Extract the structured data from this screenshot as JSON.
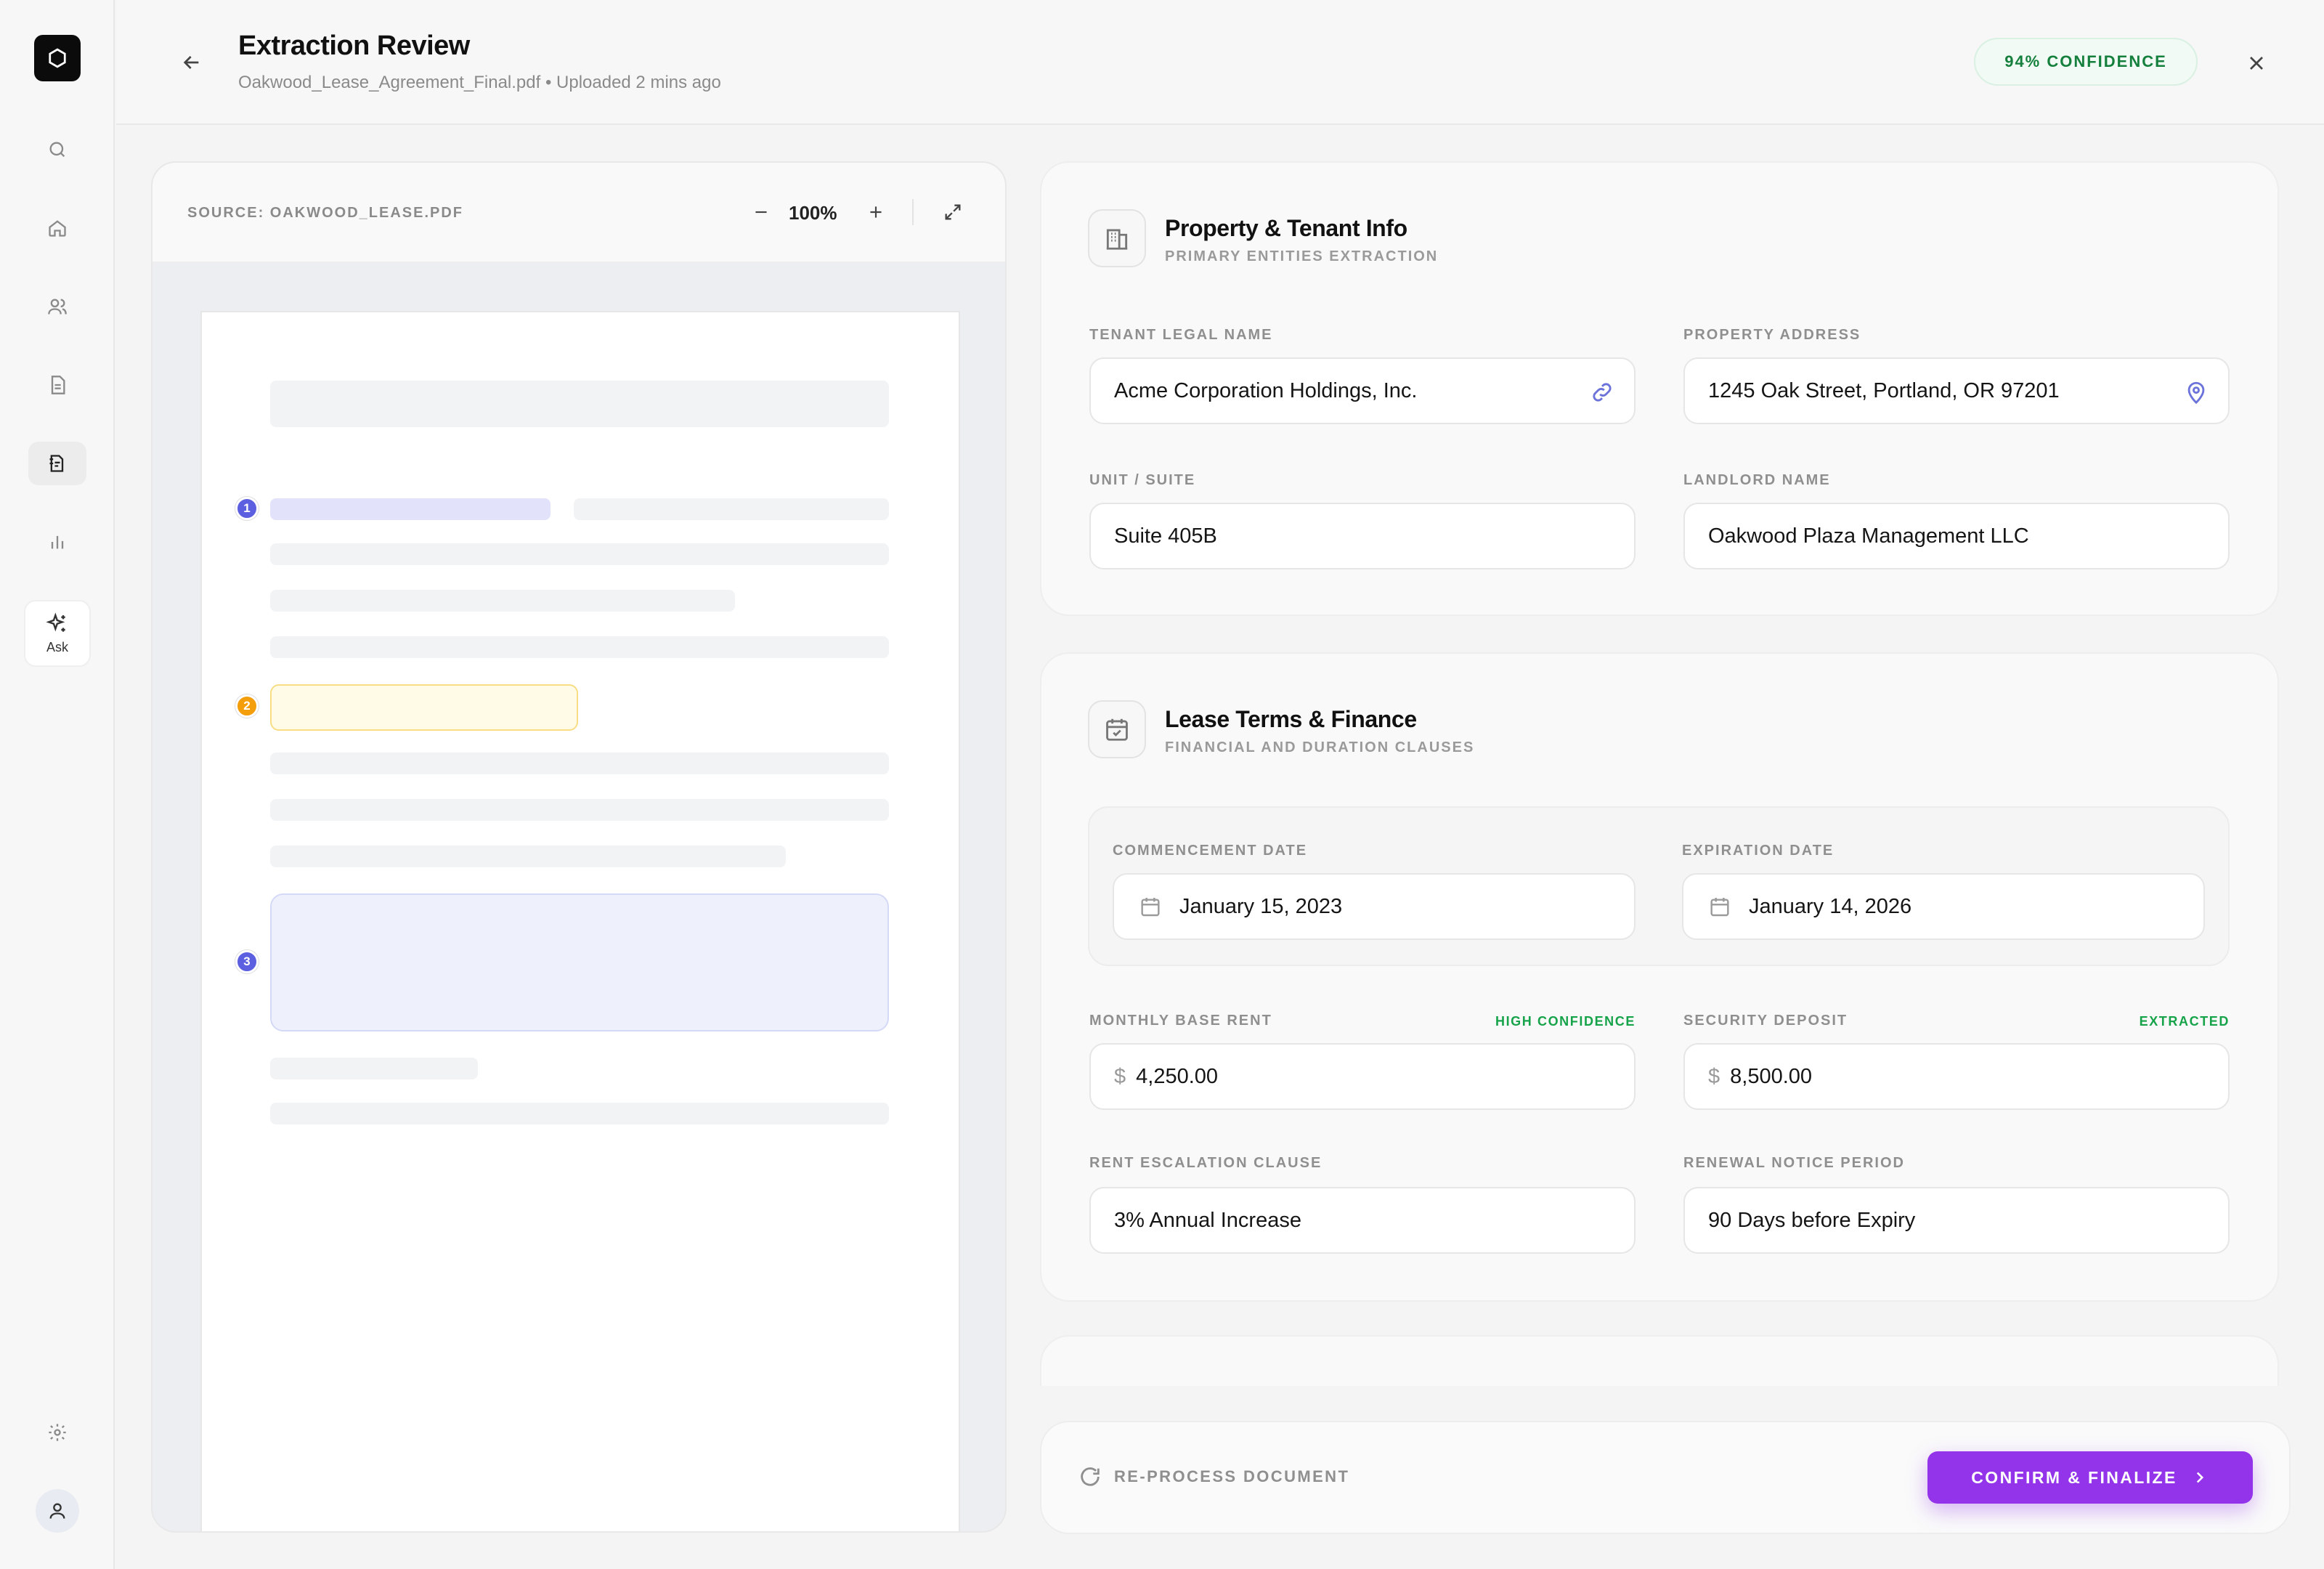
{
  "sidebar": {
    "ask_label": "Ask",
    "items": [
      "search-icon",
      "home-icon",
      "users-icon",
      "document-icon",
      "extraction-icon",
      "chart-icon",
      "sparkle-icon",
      "settings-icon",
      "user-icon"
    ]
  },
  "header": {
    "title": "Extraction Review",
    "subtitle": "Oakwood_Lease_Agreement_Final.pdf • Uploaded 2 mins ago",
    "confidence": "94% CONFIDENCE"
  },
  "pdf": {
    "source_label": "SOURCE: OAKWOOD_LEASE.PDF",
    "zoom": "100%",
    "markers": [
      "1",
      "2",
      "3"
    ]
  },
  "property_card": {
    "title": "Property & Tenant Info",
    "subtitle": "PRIMARY ENTITIES EXTRACTION",
    "fields": {
      "tenant_label": "TENANT LEGAL NAME",
      "tenant_value": "Acme Corporation Holdings, Inc.",
      "address_label": "PROPERTY ADDRESS",
      "address_value": "1245 Oak Street, Portland, OR 97201",
      "unit_label": "UNIT / SUITE",
      "unit_value": "Suite 405B",
      "landlord_label": "LANDLORD NAME",
      "landlord_value": "Oakwood Plaza Management LLC"
    }
  },
  "lease_card": {
    "title": "Lease Terms & Finance",
    "subtitle": "FINANCIAL AND DURATION CLAUSES",
    "fields": {
      "commencement_label": "COMMENCEMENT DATE",
      "commencement_value": "January 15, 2023",
      "expiration_label": "EXPIRATION DATE",
      "expiration_value": "January 14, 2026",
      "rent_label": "MONTHLY BASE RENT",
      "rent_badge": "HIGH CONFIDENCE",
      "rent_currency": "$",
      "rent_value": "4,250.00",
      "deposit_label": "SECURITY DEPOSIT",
      "deposit_badge": "EXTRACTED",
      "deposit_currency": "$",
      "deposit_value": "8,500.00",
      "escalation_label": "RENT ESCALATION CLAUSE",
      "escalation_value": "3% Annual Increase",
      "renewal_label": "RENEWAL NOTICE PERIOD",
      "renewal_value": "90 Days before Expiry"
    }
  },
  "footer": {
    "reprocess_label": "RE-PROCESS DOCUMENT",
    "confirm_label": "CONFIRM & FINALIZE"
  },
  "colors": {
    "accent": "#9333ea",
    "success": "#15803d",
    "marker_blue": "#5b5fe0",
    "marker_amber": "#f59e0b"
  }
}
